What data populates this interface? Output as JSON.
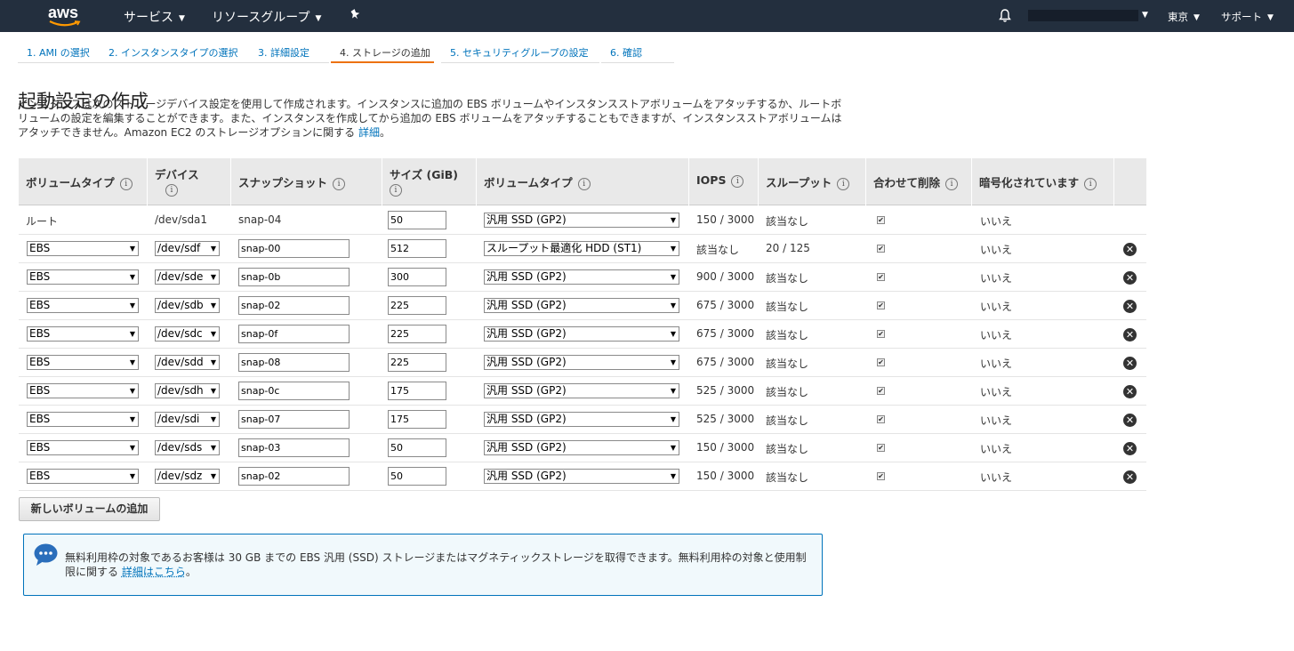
{
  "nav": {
    "logo": "aws",
    "services": "サービス",
    "resource_groups": "リソースグループ",
    "region": "東京",
    "support": "サポート"
  },
  "tabs": [
    {
      "label": "1. AMI の選択",
      "active": false
    },
    {
      "label": "2. インスタンスタイプの選択",
      "active": false
    },
    {
      "label": "3. 詳細設定",
      "active": false
    },
    {
      "label": "4. ストレージの追加",
      "active": true
    },
    {
      "label": "5. セキュリティグループの設定",
      "active": false
    },
    {
      "label": "6. 確認",
      "active": false
    }
  ],
  "page": {
    "title": "起動設定の作成",
    "description": "インスタンスは次のストレージデバイス設定を使用して作成されます。インスタンスに追加の EBS ボリュームやインスタンスストアボリュームをアタッチするか、ルートボリュームの設定を編集することができます。また、インスタンスを作成してから追加の EBS ボリュームをアタッチすることもできますが、インスタンスストアボリュームはアタッチできません。Amazon EC2 のストレージオプションに関する",
    "description_link": "詳細",
    "description_end": "。"
  },
  "table": {
    "headers": {
      "volume_type": "ボリュームタイプ",
      "device": "デバイス",
      "snapshot": "スナップショット",
      "size": "サイズ (GiB)",
      "ebs_type": "ボリュームタイプ",
      "iops": "IOPS",
      "throughput": "スループット",
      "delete_on_term": "合わせて削除",
      "encrypted": "暗号化されています"
    },
    "root_row": {
      "volume_type": "ルート",
      "device": "/dev/sda1",
      "snapshot": "snap-04",
      "size": "50",
      "ebs_type": "汎用 SSD (GP2)",
      "iops": "150 / 3000",
      "throughput": "該当なし",
      "encrypted": "いいえ"
    },
    "rows": [
      {
        "volume_type": "EBS",
        "device": "/dev/sdf",
        "snapshot": "snap-00",
        "size": "512",
        "ebs_type": "スループット最適化 HDD (ST1)",
        "iops": "該当なし",
        "throughput": "20 / 125",
        "encrypted": "いいえ"
      },
      {
        "volume_type": "EBS",
        "device": "/dev/sde",
        "snapshot": "snap-0b",
        "size": "300",
        "ebs_type": "汎用 SSD (GP2)",
        "iops": "900 / 3000",
        "throughput": "該当なし",
        "encrypted": "いいえ"
      },
      {
        "volume_type": "EBS",
        "device": "/dev/sdb",
        "snapshot": "snap-02",
        "size": "225",
        "ebs_type": "汎用 SSD (GP2)",
        "iops": "675 / 3000",
        "throughput": "該当なし",
        "encrypted": "いいえ"
      },
      {
        "volume_type": "EBS",
        "device": "/dev/sdc",
        "snapshot": "snap-0f",
        "size": "225",
        "ebs_type": "汎用 SSD (GP2)",
        "iops": "675 / 3000",
        "throughput": "該当なし",
        "encrypted": "いいえ"
      },
      {
        "volume_type": "EBS",
        "device": "/dev/sdd",
        "snapshot": "snap-08",
        "size": "225",
        "ebs_type": "汎用 SSD (GP2)",
        "iops": "675 / 3000",
        "throughput": "該当なし",
        "encrypted": "いいえ"
      },
      {
        "volume_type": "EBS",
        "device": "/dev/sdh",
        "snapshot": "snap-0c",
        "size": "175",
        "ebs_type": "汎用 SSD (GP2)",
        "iops": "525 / 3000",
        "throughput": "該当なし",
        "encrypted": "いいえ"
      },
      {
        "volume_type": "EBS",
        "device": "/dev/sdi",
        "snapshot": "snap-07",
        "size": "175",
        "ebs_type": "汎用 SSD (GP2)",
        "iops": "525 / 3000",
        "throughput": "該当なし",
        "encrypted": "いいえ"
      },
      {
        "volume_type": "EBS",
        "device": "/dev/sds",
        "snapshot": "snap-03",
        "size": "50",
        "ebs_type": "汎用 SSD (GP2)",
        "iops": "150 / 3000",
        "throughput": "該当なし",
        "encrypted": "いいえ"
      },
      {
        "volume_type": "EBS",
        "device": "/dev/sdz",
        "snapshot": "snap-02",
        "size": "50",
        "ebs_type": "汎用 SSD (GP2)",
        "iops": "150 / 3000",
        "throughput": "該当なし",
        "encrypted": "いいえ"
      }
    ]
  },
  "add_volume_label": "新しいボリュームの追加",
  "notice": {
    "text": "無料利用枠の対象であるお客様は 30 GB までの EBS 汎用 (SSD) ストレージまたはマグネティックストレージを取得できます。無料利用枠の対象と使用制限に関する",
    "link": "詳細はこちら",
    "end": "。"
  },
  "colors": {
    "nav_bg": "#232f3e",
    "link": "#0073bb",
    "active_tab": "#ec7211",
    "notice_bg": "#f1f9fc"
  }
}
